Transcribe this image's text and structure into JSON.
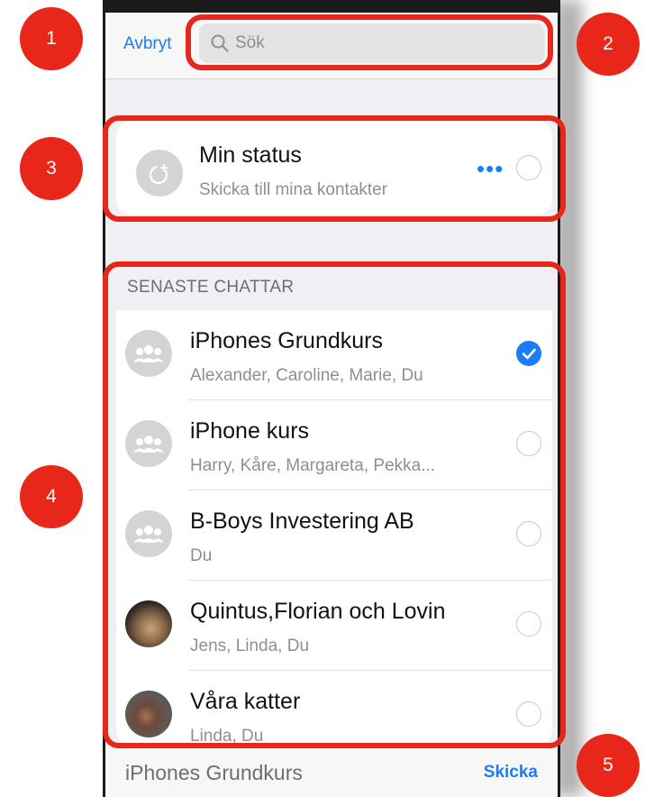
{
  "header": {
    "cancel_label": "Avbryt",
    "search_placeholder": "Sök"
  },
  "status": {
    "title": "Min status",
    "subtitle": "Skicka till mina kontakter",
    "more": "•••"
  },
  "chats": {
    "section_label": "SENASTE CHATTAR",
    "items": [
      {
        "title": "iPhones Grundkurs",
        "subtitle": "Alexander, Caroline, Marie, Du",
        "selected": true,
        "avatar": "group-icon"
      },
      {
        "title": "iPhone kurs",
        "subtitle": "Harry, Kåre, Margareta, Pekka...",
        "selected": false,
        "avatar": "group-icon"
      },
      {
        "title": "B-Boys Investering AB",
        "subtitle": "Du",
        "selected": false,
        "avatar": "group-icon"
      },
      {
        "title": "Quintus,Florian och Lovin",
        "subtitle": "Jens, Linda, Du",
        "selected": false,
        "avatar": "photo-cats"
      },
      {
        "title": "Våra katter",
        "subtitle": "Linda, Du",
        "selected": false,
        "avatar": "photo-cat"
      }
    ]
  },
  "footer": {
    "selected_text": "iPhones Grundkurs",
    "send_label": "Skicka"
  },
  "callouts": [
    "1",
    "2",
    "3",
    "4",
    "5"
  ],
  "colors": {
    "accent": "#1b7cf3",
    "callout": "#e8271a"
  }
}
